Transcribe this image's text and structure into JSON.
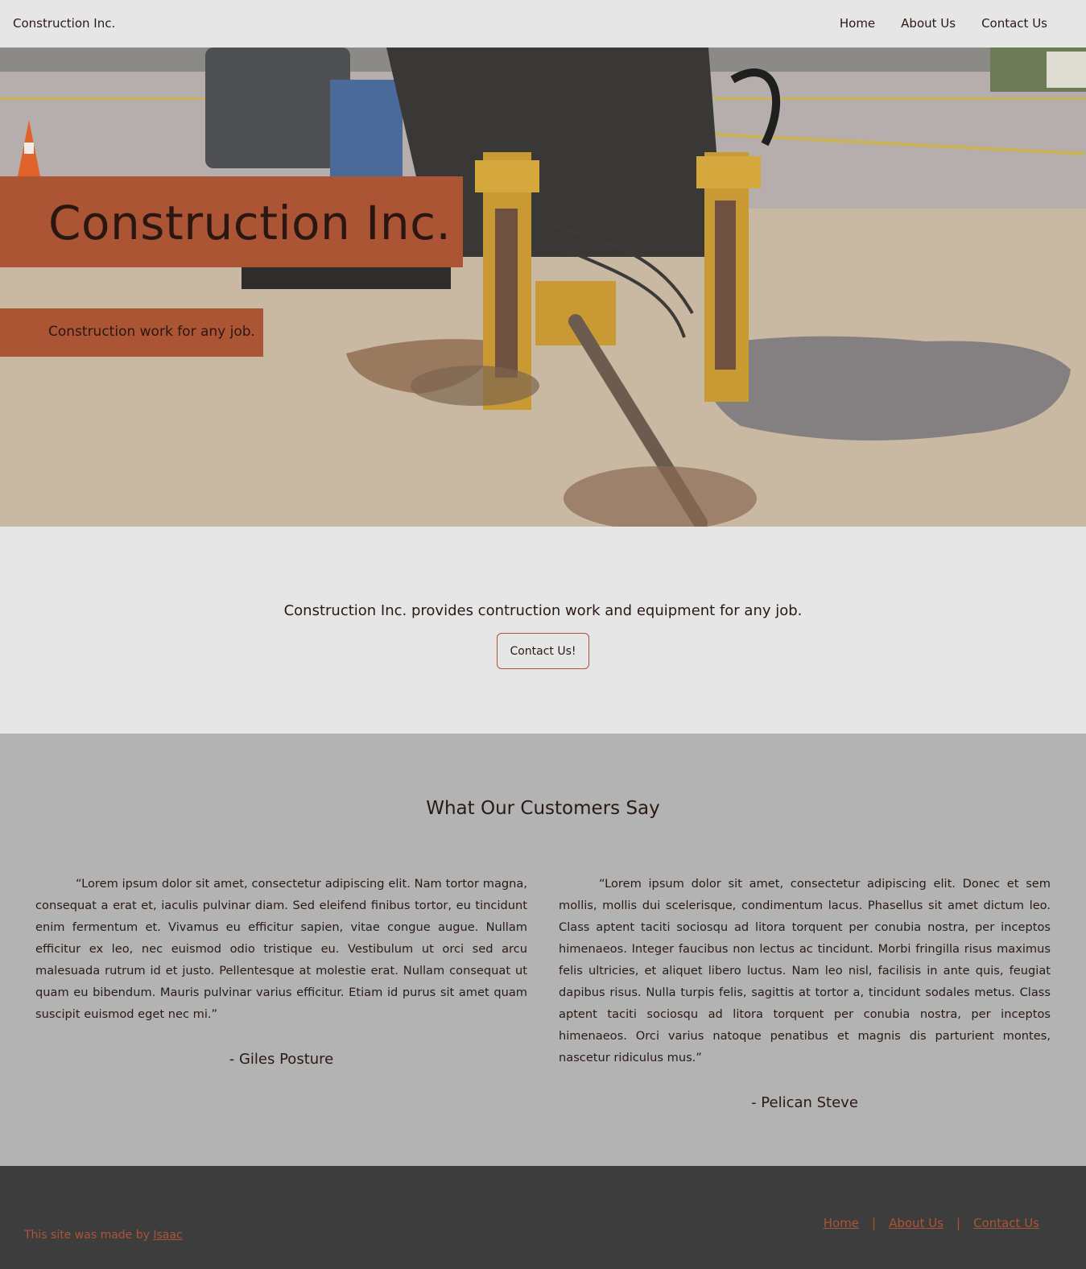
{
  "nav": {
    "brand": "Construction Inc.",
    "links": [
      "Home",
      "About Us",
      "Contact Us"
    ]
  },
  "hero": {
    "title": "Construction Inc.",
    "subtitle": "Construction work for any job."
  },
  "intro": {
    "text": "Construction Inc. provides contruction work and equipment for any job.",
    "button_label": "Contact Us!"
  },
  "testimonials": {
    "heading": "What Our Customers Say",
    "items": [
      {
        "quote": "“Lorem ipsum dolor sit amet, consectetur adipiscing elit. Nam tortor magna, consequat a erat et, iaculis pulvinar diam. Sed eleifend finibus tortor, eu tincidunt enim fermentum et. Vivamus eu efficitur sapien, vitae congue augue. Nullam efficitur ex leo, nec euismod odio tristique eu. Vestibulum ut orci sed arcu malesuada rutrum id et justo. Pellentesque at molestie erat. Nullam consequat ut quam eu bibendum. Mauris pulvinar varius efficitur. Etiam id purus sit amet quam suscipit euismod eget nec mi.”",
        "author": "- Giles Posture"
      },
      {
        "quote": "“Lorem ipsum dolor sit amet, consectetur adipiscing elit. Donec et sem mollis, mollis dui scelerisque, condimentum lacus. Phasellus sit amet dictum leo. Class aptent taciti sociosqu ad litora torquent per conubia nostra, per inceptos himenaeos. Integer faucibus non lectus ac tincidunt. Morbi fringilla risus maximus felis ultricies, et aliquet libero luctus. Nam leo nisl, facilisis in ante quis, feugiat dapibus risus. Nulla turpis felis, sagittis at tortor a, tincidunt sodales metus. Class aptent taciti sociosqu ad litora torquent per conubia nostra, per inceptos himenaeos. Orci varius natoque penatibus et magnis dis parturient montes, nascetur ridiculus mus.”",
        "author": "- Pelican Steve"
      }
    ]
  },
  "footer": {
    "made_by_prefix": "This site was made by ",
    "made_by_link": "Isaac",
    "links": [
      "Home",
      "About Us",
      "Contact Us"
    ],
    "separator": "|"
  },
  "colors": {
    "accent": "#ac5535",
    "nav_bg": "#e6e6e6",
    "testimonials_bg": "#b3b3b3",
    "footer_bg": "#3d3d3d",
    "text": "#2a1a14"
  }
}
